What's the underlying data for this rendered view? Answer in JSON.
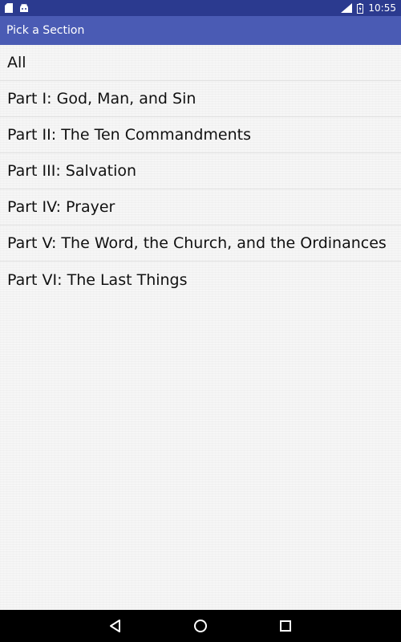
{
  "status_bar": {
    "time": "10:55",
    "left_icons": [
      "sd-card-icon",
      "android-icon"
    ],
    "right_icons": [
      "lte-signal-icon",
      "battery-icon"
    ]
  },
  "app_bar": {
    "title": "Pick a Section"
  },
  "sections": [
    {
      "label": "All"
    },
    {
      "label": "Part I: God, Man, and Sin"
    },
    {
      "label": "Part II: The Ten Commandments"
    },
    {
      "label": "Part III: Salvation"
    },
    {
      "label": "Part IV: Prayer"
    },
    {
      "label": "Part V: The Word, the Church, and the Ordinances"
    },
    {
      "label": "Part VI: The Last Things"
    }
  ],
  "nav_bar": {
    "buttons": [
      "back-icon",
      "home-icon",
      "recents-icon"
    ]
  },
  "colors": {
    "status_bar": "#2b3a8f",
    "app_bar": "#4a5bb4",
    "background": "#f6f6f6",
    "nav_bar": "#000000"
  }
}
